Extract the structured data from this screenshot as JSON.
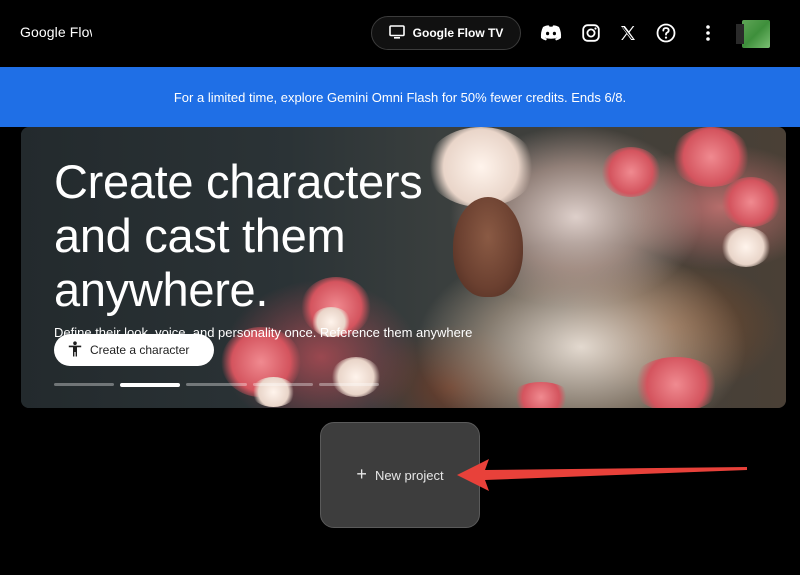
{
  "header": {
    "brand": "Google Flow",
    "tv_button_label": "Google Flow TV",
    "icons": [
      "discord-icon",
      "instagram-icon",
      "x-icon",
      "help-icon",
      "more-vert-icon"
    ]
  },
  "banner": {
    "text": "For a limited time, explore Gemini Omni Flash for 50% fewer credits. Ends 6/8."
  },
  "hero": {
    "title": "Create characters and cast them anywhere.",
    "subtitle": "Define their look, voice, and personality once. Reference them anywhere",
    "cta_label": "Create a character",
    "carousel": {
      "count": 5,
      "active": 1
    }
  },
  "main": {
    "new_project_label": "New project"
  },
  "colors": {
    "background": "#000000",
    "banner": "#1f6fe6",
    "card": "#3d3d3d",
    "arrow": "#e8413a"
  }
}
